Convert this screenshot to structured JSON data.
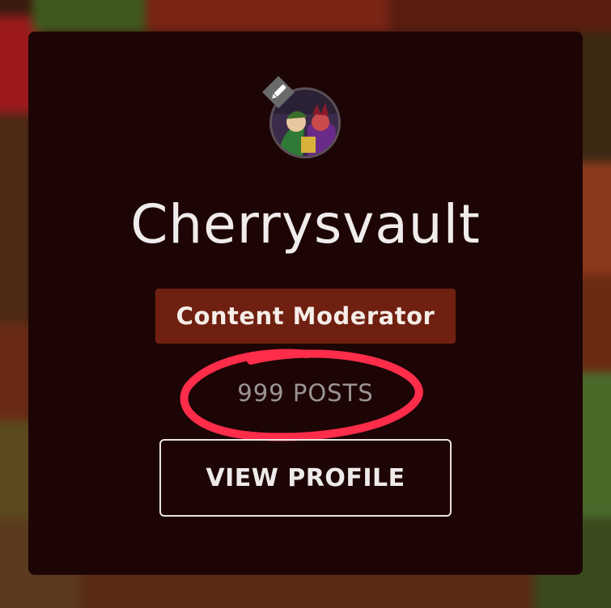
{
  "profile": {
    "username": "Cherrysvault",
    "role": "Content Moderator",
    "posts_label": "999 POSTS",
    "view_profile_label": "VIEW PROFILE"
  },
  "icons": {
    "edit": "pencil-icon",
    "avatar": "avatar-image"
  },
  "colors": {
    "card_background": "#1e0505",
    "role_badge": "#6f2010",
    "annotation_circle": "#ff2d4a",
    "posts_text": "#9a9494"
  }
}
